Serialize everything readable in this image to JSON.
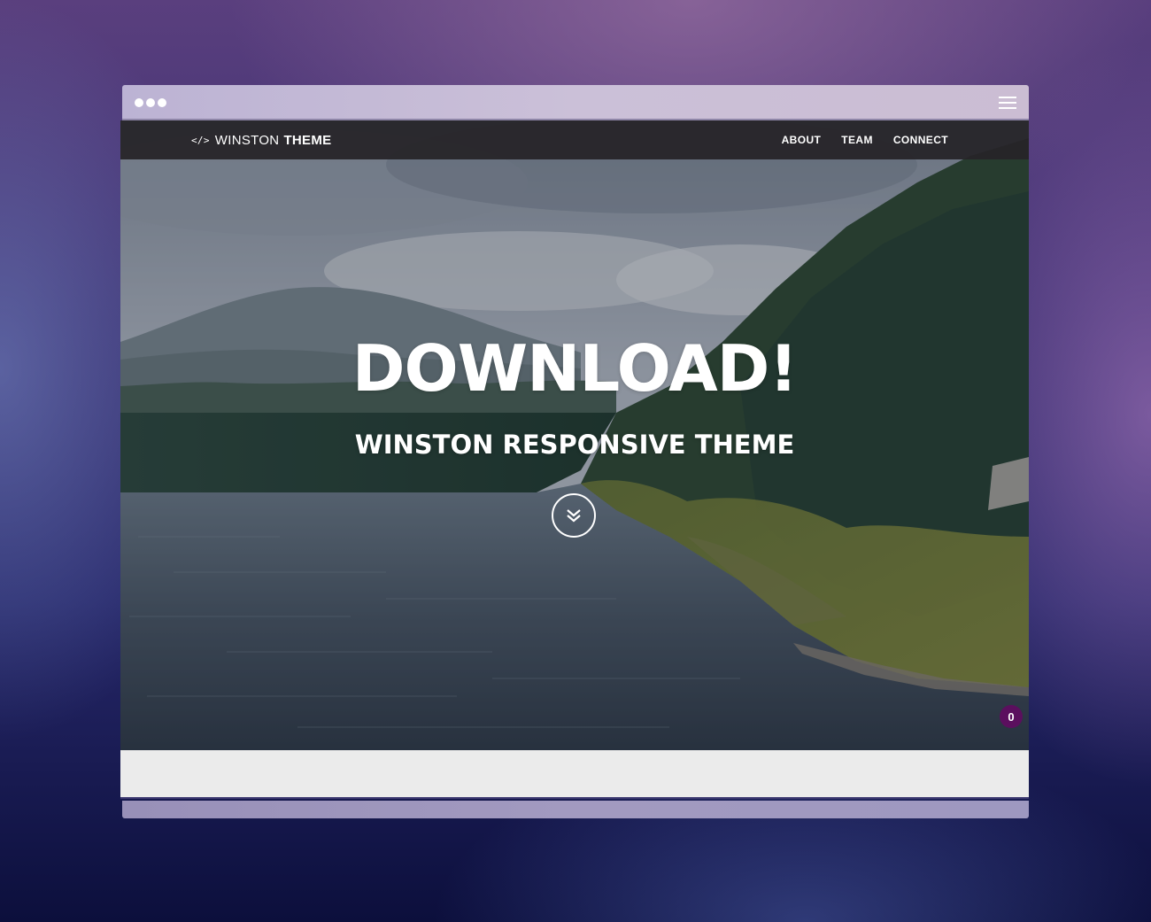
{
  "navbar": {
    "brand_icon": "</>",
    "brand_light": "WINSTON",
    "brand_bold": "THEME",
    "links": [
      "ABOUT",
      "TEAM",
      "CONNECT"
    ]
  },
  "hero": {
    "title": "DOWNLOAD!",
    "subtitle": "WINSTON RESPONSIVE THEME",
    "scroll_icon": "double-chevron-down-icon"
  },
  "badge": {
    "count": "0",
    "color": "#5b0f5e"
  },
  "colors": {
    "navbar_bg": "#262428",
    "section_bg": "#ebebeb"
  }
}
